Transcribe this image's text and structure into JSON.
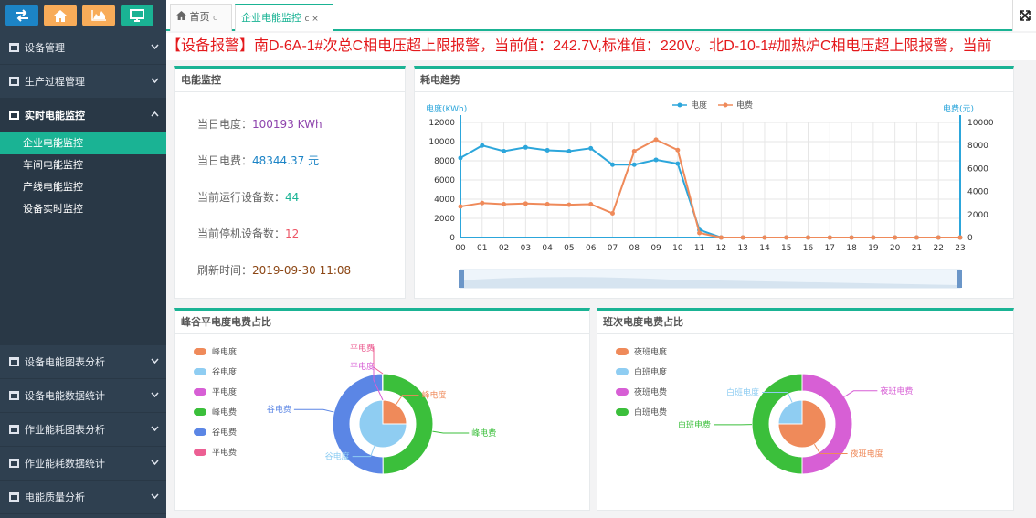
{
  "sidebar": {
    "top_icons": [
      {
        "icon": "exchange-icon",
        "color": "#1c84c6"
      },
      {
        "icon": "home-icon",
        "color": "#f8ac59"
      },
      {
        "icon": "area-chart-icon",
        "color": "#f8ac59"
      },
      {
        "icon": "monitor-icon",
        "color": "#1ab394"
      }
    ],
    "menu": [
      {
        "label": "设备管理"
      },
      {
        "label": "生产过程管理"
      },
      {
        "label": "实时电能监控"
      }
    ],
    "submenu": [
      "企业电能监控",
      "车间电能监控",
      "产线电能监控",
      "设备实时监控"
    ],
    "menu_bottom": [
      {
        "label": "设备电能图表分析"
      },
      {
        "label": "设备电能数据统计"
      },
      {
        "label": "作业能耗图表分析"
      },
      {
        "label": "作业能耗数据统计"
      },
      {
        "label": "电能质量分析"
      }
    ]
  },
  "tabs": [
    {
      "label": "首页",
      "close": "c"
    },
    {
      "label": "企业电能监控",
      "close": "c ×"
    }
  ],
  "alarm": "【设备报警】南D-6A-1#次总C相电压超上限报警，当前值：242.7V,标准值：220V。北D-10-1#加热炉C相电压超上限报警，当前",
  "monitor": {
    "title": "电能监控",
    "items": [
      {
        "label": "当日电度：",
        "value": "100193 KWh",
        "color": "#8e44ad"
      },
      {
        "label": "当日电费：",
        "value": "48344.37 元",
        "color": "#1c84c6"
      },
      {
        "label": "当前运行设备数：",
        "value": "44",
        "color": "#1ab394"
      },
      {
        "label": "当前停机设备数：",
        "value": "12",
        "color": "#ed5565"
      },
      {
        "label": "刷新时间：",
        "value": "2019-09-30 11:08",
        "color": "#8b4513"
      }
    ]
  },
  "trend": {
    "title": "耗电趋势",
    "left_unit": "电度(KWh)",
    "right_unit": "电费(元)",
    "legend": [
      "电度",
      "电费"
    ]
  },
  "chart_data": {
    "type": "line",
    "x": [
      "00",
      "01",
      "02",
      "03",
      "04",
      "05",
      "06",
      "07",
      "08",
      "09",
      "10",
      "11",
      "12",
      "13",
      "14",
      "15",
      "16",
      "17",
      "18",
      "19",
      "20",
      "21",
      "22",
      "23"
    ],
    "ylabel": "电度(KWh)",
    "y2label": "电费(元)",
    "ylim": [
      0,
      12000
    ],
    "y2lim": [
      0,
      10000
    ],
    "yticks": [
      0,
      2000,
      4000,
      6000,
      8000,
      10000,
      12000
    ],
    "y2ticks": [
      0,
      2000,
      4000,
      6000,
      8000,
      10000
    ],
    "grid": true,
    "legend_position": "top-center",
    "series": [
      {
        "name": "电度",
        "axis": "left",
        "color": "#2ca6db",
        "values": [
          8300,
          9600,
          9000,
          9400,
          9100,
          9000,
          9300,
          7600,
          7600,
          8100,
          7700,
          800,
          0,
          0,
          0,
          0,
          0,
          0,
          0,
          0,
          0,
          0,
          0,
          0
        ]
      },
      {
        "name": "电费",
        "axis": "right",
        "color": "#ef8a5a",
        "values": [
          2700,
          3000,
          2900,
          2950,
          2900,
          2850,
          2900,
          2100,
          7500,
          8500,
          7600,
          400,
          0,
          0,
          0,
          0,
          0,
          0,
          0,
          0,
          0,
          0,
          0,
          0
        ]
      }
    ]
  },
  "peak_valley": {
    "title": "峰谷平电度电费占比",
    "legend": [
      {
        "label": "峰电度",
        "color": "#ef8a5a"
      },
      {
        "label": "谷电度",
        "color": "#8fcdf2"
      },
      {
        "label": "平电度",
        "color": "#d75fd5"
      },
      {
        "label": "峰电费",
        "color": "#3bbf3b"
      },
      {
        "label": "谷电费",
        "color": "#5b86e5"
      },
      {
        "label": "平电费",
        "color": "#ec5f93"
      }
    ],
    "inner": [
      {
        "label": "峰电度",
        "value": 25,
        "color": "#ef8a5a"
      },
      {
        "label": "谷电度",
        "value": 75,
        "color": "#8fcdf2"
      },
      {
        "label": "平电度",
        "value": 0.1,
        "color": "#d75fd5"
      }
    ],
    "outer": [
      {
        "label": "峰电费",
        "value": 50,
        "color": "#3bbf3b"
      },
      {
        "label": "谷电费",
        "value": 50,
        "color": "#5b86e5"
      },
      {
        "label": "平电费",
        "value": 0.1,
        "color": "#ec5f93"
      }
    ]
  },
  "shift": {
    "title": "班次电度电费占比",
    "legend": [
      {
        "label": "夜班电度",
        "color": "#ef8a5a"
      },
      {
        "label": "白班电度",
        "color": "#8fcdf2"
      },
      {
        "label": "夜班电费",
        "color": "#d75fd5"
      },
      {
        "label": "白班电费",
        "color": "#3bbf3b"
      }
    ],
    "inner": [
      {
        "label": "夜班电度",
        "value": 0,
        "color": "#ef8a5a"
      },
      {
        "label": "白班电度",
        "value": 25,
        "color": "#8fcdf2"
      },
      {
        "label": "夜班电度",
        "value": 75,
        "color": "#ef8a5a"
      }
    ],
    "outer": [
      {
        "label": "白班电费",
        "value": 50,
        "color": "#3bbf3b"
      },
      {
        "label": "夜班电费",
        "value": 50,
        "color": "#d75fd5"
      }
    ]
  }
}
